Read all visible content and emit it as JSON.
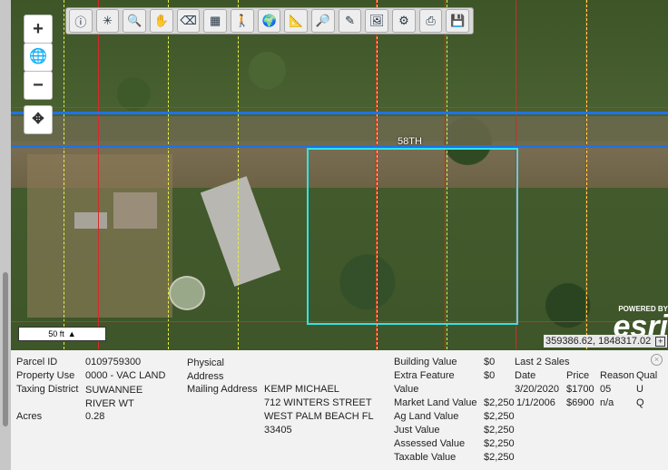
{
  "map": {
    "road_label": "58TH",
    "scale_label": "50 ft",
    "coordinates": "359386.62, 1848317.02",
    "esri": {
      "powered_by": "POWERED BY",
      "brand": "esri"
    }
  },
  "zoom": {
    "in": "+",
    "globe": "🌐",
    "out": "−",
    "pan": "✥"
  },
  "toolbar": {
    "tools": [
      {
        "icon": "info-icon",
        "glyph": "ⓘ"
      },
      {
        "icon": "select-icon",
        "glyph": "✳"
      },
      {
        "icon": "zoom-in-icon",
        "glyph": "🔍"
      },
      {
        "icon": "pan-hand-icon",
        "glyph": "✋"
      },
      {
        "icon": "eraser-icon",
        "glyph": "⌫"
      },
      {
        "icon": "add-layer-icon",
        "glyph": "▦"
      },
      {
        "icon": "street-view-icon",
        "glyph": "🚶"
      },
      {
        "icon": "globe-icon",
        "glyph": "🌍"
      },
      {
        "icon": "measure-icon",
        "glyph": "📐"
      },
      {
        "icon": "search-icon",
        "glyph": "🔎"
      },
      {
        "icon": "pencil-icon",
        "glyph": "✎"
      },
      {
        "icon": "print-map-icon",
        "glyph": "🖼"
      },
      {
        "icon": "settings-icon",
        "glyph": "⚙"
      },
      {
        "icon": "printer-icon",
        "glyph": "⎙"
      },
      {
        "icon": "save-icon",
        "glyph": "💾"
      }
    ]
  },
  "parcel": {
    "parcel_id_label": "Parcel ID",
    "parcel_id": "0109759300",
    "property_use_label": "Property Use",
    "property_use": "0000 - VAC LAND",
    "taxing_district_label": "Taxing District",
    "taxing_district": "SUWANNEE RIVER WT",
    "acres_label": "Acres",
    "acres": "0.28",
    "physical_address_label": "Physical Address",
    "mailing_address_label": "Mailing Address",
    "mailing_lines": [
      "KEMP MICHAEL",
      "712 WINTERS STREET",
      "WEST PALM BEACH FL",
      "33405"
    ],
    "building_value_label": "Building Value",
    "building_value": "$0",
    "extra_feature_label": "Extra Feature Value",
    "extra_feature": "$0",
    "market_land_label": "Market Land Value",
    "market_land": "$2,250",
    "ag_land_label": "Ag Land Value",
    "ag_land": "$2,250",
    "just_value_label": "Just Value",
    "just_value": "$2,250",
    "assessed_label": "Assessed Value",
    "assessed": "$2,250",
    "taxable_label": "Taxable Value",
    "taxable": "$2,250",
    "sales_title": "Last 2 Sales",
    "sales_headers": [
      "Date",
      "Price",
      "Reason",
      "Qual"
    ],
    "sales": [
      {
        "date": "3/20/2020",
        "price": "$1700",
        "reason": "05",
        "qual": "U"
      },
      {
        "date": "1/1/2006",
        "price": "$6900",
        "reason": "n/a",
        "qual": "Q"
      }
    ]
  }
}
